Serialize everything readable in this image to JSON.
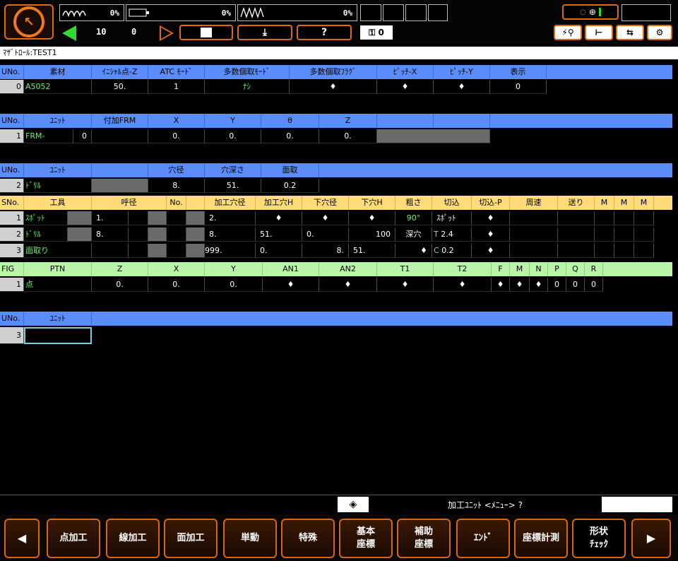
{
  "colors": {
    "accent": "#e06a10",
    "blue_header": "#5b8dfa",
    "yellow_header": "#ffdc78",
    "green_header": "#b8f5a8",
    "green_text": "#6ef06e"
  },
  "topbar": {
    "meter1_pct": "0%",
    "meter2_pct": "0%",
    "meter3_pct": "0%",
    "counter_a": "10",
    "counter_b": "0",
    "help_label": "?",
    "key_count": "0"
  },
  "title": "ﾏｻﾞﾄﾛｰﾙ:TEST1",
  "material": {
    "headers": [
      "UNo.",
      "素材",
      "ｲﾆｼｬﾙ点-Z",
      "ATC ﾓｰﾄﾞ",
      "多数個取ﾓｰﾄﾞ",
      "多数個取ﾌﾗｸﾞ",
      "ﾋﾟｯﾁ-X",
      "ﾋﾟｯﾁ-Y",
      "表示"
    ],
    "row": [
      "0",
      "A5052",
      "50.",
      "1",
      "ﾅｼ",
      "♦",
      "♦",
      "♦",
      "0"
    ]
  },
  "unit1": {
    "headers": [
      "UNo.",
      "ﾕﾆｯﾄ",
      "付加FRM",
      "X",
      "Y",
      "θ",
      "Z"
    ],
    "row": [
      "1",
      "FRM-",
      "0",
      "0.",
      "0.",
      "0.",
      "0."
    ]
  },
  "unit2": {
    "headers": [
      "UNo.",
      "ﾕﾆｯﾄ",
      "",
      "穴径",
      "穴深さ",
      "面取"
    ],
    "row": [
      "2",
      "ﾄﾞﾘﾙ",
      "",
      "8.",
      "51.",
      "0.2"
    ]
  },
  "tools": {
    "headers": [
      "SNo.",
      "工具",
      "呼径",
      "No.",
      "加工穴径",
      "加工穴H",
      "下穴径",
      "下穴H",
      "粗さ",
      "切込",
      "切込-P",
      "周速",
      "送り",
      "M",
      "M",
      "M"
    ],
    "rows": [
      [
        "1",
        "ｽﾎﾟｯﾄ",
        "1.",
        "",
        "2.",
        "♦",
        "♦",
        "♦",
        "90°",
        "ｽﾎﾟｯﾄ",
        "♦",
        "",
        ""
      ],
      [
        "2",
        "ﾄﾞﾘﾙ",
        "8.",
        "",
        "8.",
        "51.",
        "0.",
        "100",
        "深穴",
        "T",
        "2.4",
        "♦"
      ],
      [
        "3",
        "面取り",
        "",
        "",
        "999.",
        "0.",
        "8.",
        "51.",
        "♦",
        "C",
        "0.2",
        "♦"
      ]
    ]
  },
  "figure": {
    "headers": [
      "FIG",
      "PTN",
      "Z",
      "X",
      "Y",
      "AN1",
      "AN2",
      "T1",
      "T2",
      "F",
      "M",
      "N",
      "P",
      "Q",
      "R"
    ],
    "row": [
      "1",
      "点",
      "0.",
      "0.",
      "0.",
      "♦",
      "♦",
      "♦",
      "♦",
      "♦",
      "♦",
      "♦",
      "0",
      "0",
      "0"
    ]
  },
  "unit3": {
    "headers": [
      "UNo.",
      "ﾕﾆｯﾄ"
    ],
    "row": [
      "3",
      ""
    ]
  },
  "status": {
    "prompt": "加工ﾕﾆｯﾄ <ﾒﾆｭｰ> ?"
  },
  "fkeys": [
    "点加工",
    "線加工",
    "面加工",
    "単動",
    "特殊",
    "基本",
    "座標",
    "補助",
    "座標",
    "ｴﾝﾄﾞ",
    "座標計測",
    "形状",
    "ﾁｪｯｸ"
  ]
}
